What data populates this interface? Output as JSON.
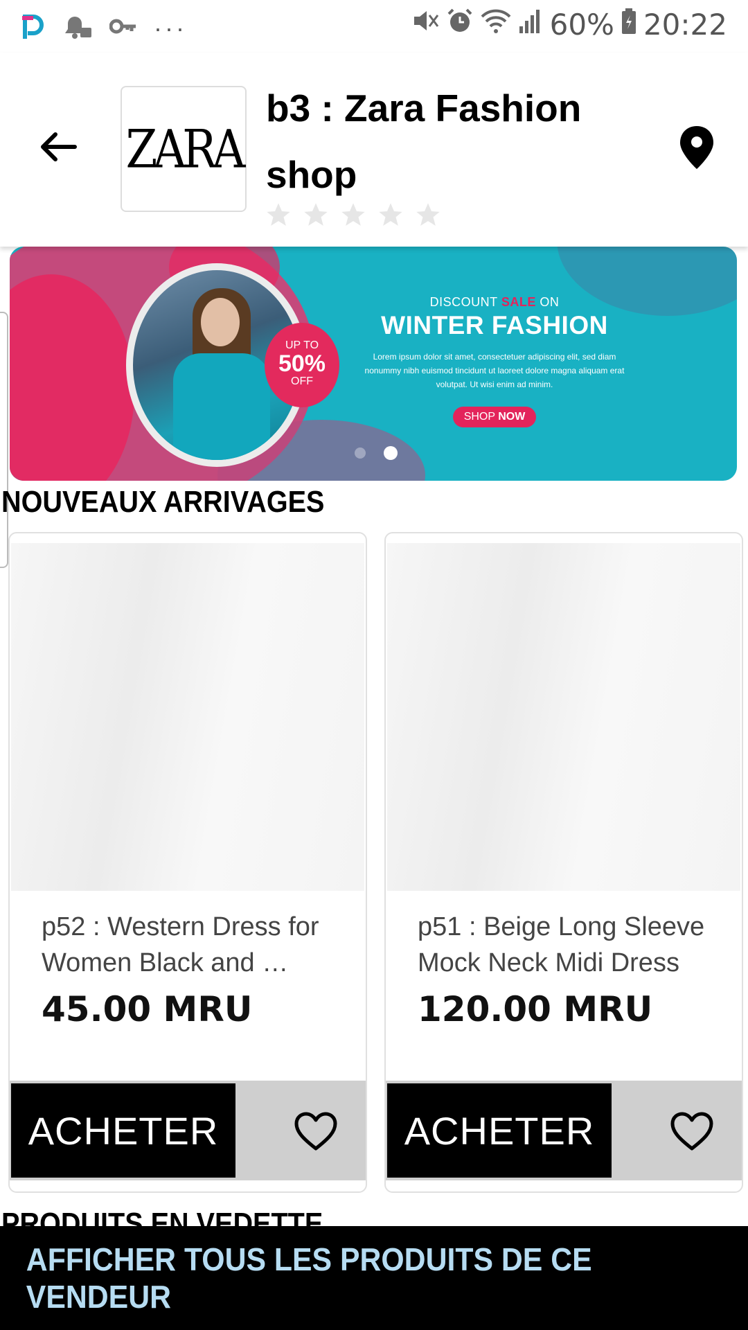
{
  "status_bar": {
    "battery": "60%",
    "time": "20:22",
    "left_icons": [
      "app-p-icon",
      "notification-bell-icon",
      "key-icon",
      "more-dots-icon"
    ],
    "right_icons": [
      "mute-icon",
      "alarm-icon",
      "wifi-icon",
      "signal-icon",
      "battery-icon"
    ]
  },
  "header": {
    "title": "b3 : Zara Fashion shop",
    "logo_text": "ZARA",
    "rating": 0,
    "rating_max": 5
  },
  "banner": {
    "line1_prefix": "DISCOUNT",
    "line1_highlight": "SALE",
    "line1_suffix": "ON",
    "headline": "WINTER FASHION",
    "body": "Lorem ipsum dolor sit amet, consectetuer adipiscing elit, sed diam nonummy nibh euismod tincidunt ut laoreet dolore magna aliquam erat volutpat. Ut wisi enim ad minim.",
    "badge_top": "UP TO",
    "badge_value": "50%",
    "badge_bottom": "OFF",
    "cta_part1": "SHOP",
    "cta_part2": "NOW",
    "colors": {
      "teal": "#19b1c3",
      "pink": "#e3245b"
    }
  },
  "sections": {
    "new_arrivals": "NOUVEAUX ARRIVAGES",
    "featured": "PRODUITS EN VEDETTE"
  },
  "products": [
    {
      "name": "p52 : Western Dress for Women Black and …",
      "price": "45.00 MRU",
      "buy_label": "ACHETER"
    },
    {
      "name": "p51 : Beige Long Sleeve Mock Neck Midi Dress",
      "price": "120.00 MRU",
      "buy_label": "ACHETER"
    }
  ],
  "footer": {
    "button_label": "AFFICHER TOUS LES PRODUITS DE CE VENDEUR",
    "text_color": "#b6dcf2"
  }
}
